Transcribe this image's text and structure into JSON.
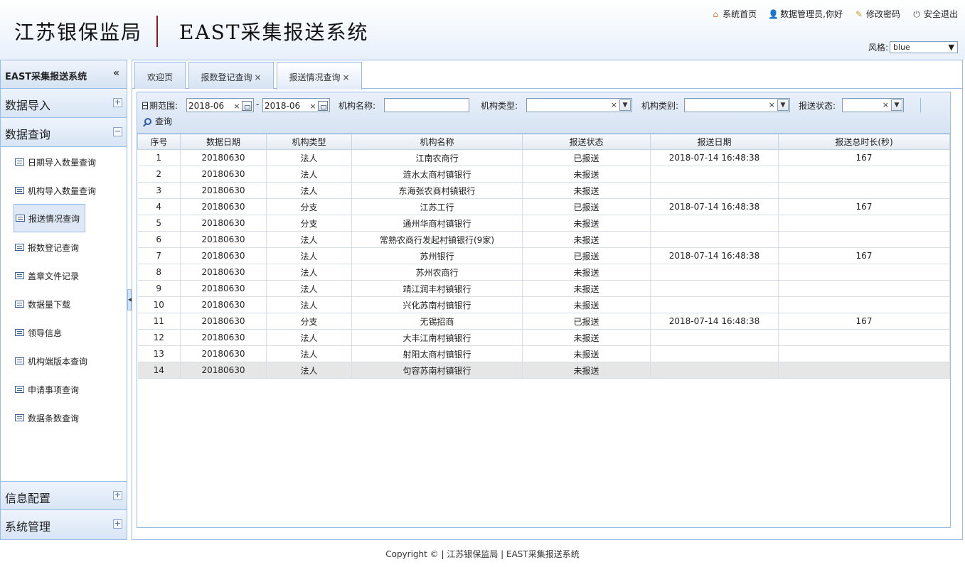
{
  "header": {
    "org_name": "江苏银保监局",
    "system_name": "EAST采集报送系统",
    "nav": [
      {
        "icon": "home-icon",
        "label": "系统首页"
      },
      {
        "icon": "user-icon",
        "label": "数据管理员,你好"
      },
      {
        "icon": "edit-icon",
        "label": "修改密码"
      },
      {
        "icon": "power-icon",
        "label": "安全退出"
      }
    ],
    "style_label": "风格:",
    "style_value": "blue"
  },
  "sidebar": {
    "title": "EAST采集报送系统",
    "collapse_glyph": "«",
    "panels": {
      "import": {
        "label": "数据导入",
        "tool": "+"
      },
      "query": {
        "label": "数据查询",
        "tool": "−"
      },
      "config": {
        "label": "信息配置",
        "tool": "+"
      },
      "admin": {
        "label": "系统管理",
        "tool": "+"
      }
    },
    "items": [
      "日期导入数量查询",
      "机构导入数量查询",
      "报送情况查询",
      "报数登记查询",
      "盖章文件记录",
      "数据量下载",
      "领导信息",
      "机构端版本查询",
      "申请事项查询",
      "数据条数查询"
    ],
    "active_index": 2
  },
  "tabs": [
    {
      "label": "欢迎页",
      "closable": false
    },
    {
      "label": "报数登记查询",
      "closable": true
    },
    {
      "label": "报送情况查询",
      "closable": true,
      "active": true
    }
  ],
  "tab_close_glyph": "×",
  "filters": {
    "date_range_label": "日期范围:",
    "date_from": "2018-06",
    "date_to": "2018-06",
    "date_sep": "-",
    "clear_glyph": "×",
    "inst_name_label": "机构名称:",
    "inst_type_label": "机构类型:",
    "inst_category_label": "机构类别:",
    "status_label": "报送状态:",
    "query_label": "查询"
  },
  "table": {
    "columns": [
      "序号",
      "数据日期",
      "机构类型",
      "机构名称",
      "报送状态",
      "报送日期",
      "报送总时长(秒)"
    ],
    "rows": [
      [
        "1",
        "20180630",
        "法人",
        "江南农商行",
        "已报送",
        "2018-07-14 16:48:38",
        "167"
      ],
      [
        "2",
        "20180630",
        "法人",
        "涟水太商村镇银行",
        "未报送",
        "",
        ""
      ],
      [
        "3",
        "20180630",
        "法人",
        "东海张农商村镇银行",
        "未报送",
        "",
        ""
      ],
      [
        "4",
        "20180630",
        "分支",
        "江苏工行",
        "已报送",
        "2018-07-14 16:48:38",
        "167"
      ],
      [
        "5",
        "20180630",
        "分支",
        "通州华商村镇银行",
        "未报送",
        "",
        ""
      ],
      [
        "6",
        "20180630",
        "法人",
        "常熟农商行发起村镇银行(9家)",
        "未报送",
        "",
        ""
      ],
      [
        "7",
        "20180630",
        "法人",
        "苏州银行",
        "已报送",
        "2018-07-14 16:48:38",
        "167"
      ],
      [
        "8",
        "20180630",
        "法人",
        "苏州农商行",
        "未报送",
        "",
        ""
      ],
      [
        "9",
        "20180630",
        "法人",
        "靖江润丰村镇银行",
        "未报送",
        "",
        ""
      ],
      [
        "10",
        "20180630",
        "法人",
        "兴化苏南村镇银行",
        "未报送",
        "",
        ""
      ],
      [
        "11",
        "20180630",
        "分支",
        "无锡招商",
        "已报送",
        "2018-07-14 16:48:38",
        "167"
      ],
      [
        "12",
        "20180630",
        "法人",
        "大丰江南村镇银行",
        "未报送",
        "",
        ""
      ],
      [
        "13",
        "20180630",
        "法人",
        "射阳太商村镇银行",
        "未报送",
        "",
        ""
      ],
      [
        "14",
        "20180630",
        "法人",
        "句容苏南村镇银行",
        "未报送",
        "",
        ""
      ]
    ]
  },
  "footer": "Copyright © | 江苏银保监局 | EAST采集报送系统",
  "colors": {
    "accent": "#99bbe8",
    "header_divider": "#8b1a1a",
    "selected_row": "#e6e6e6"
  }
}
